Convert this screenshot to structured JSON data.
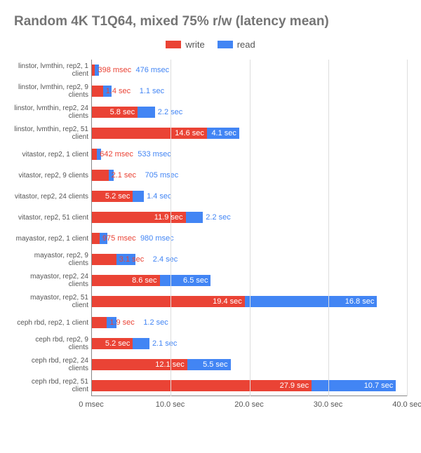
{
  "chart_data": {
    "type": "bar",
    "stacked": true,
    "orientation": "horizontal",
    "title": "Random 4K T1Q64, mixed 75% r/w (latency mean)",
    "xlim_sec": [
      0,
      40
    ],
    "xticks": [
      {
        "pct": 0,
        "label": "0 msec"
      },
      {
        "pct": 25,
        "label": "10.0 sec"
      },
      {
        "pct": 50,
        "label": "20.0 sec"
      },
      {
        "pct": 75,
        "label": "30.0 sec"
      },
      {
        "pct": 100,
        "label": "40.0 sec"
      }
    ],
    "legend": [
      {
        "key": "write",
        "label": "write",
        "color": "#ea4335"
      },
      {
        "key": "read",
        "label": "read",
        "color": "#4285f4"
      }
    ],
    "categories": [
      "linstor, lvmthin, rep2, 1 client",
      "linstor, lvmthin, rep2, 9 clients",
      "linstor, lvmthin, rep2, 24 clients",
      "linstor, lvmthin, rep2, 51 client",
      "vitastor, rep2, 1 client",
      "vitastor, rep2, 9 clients",
      "vitastor, rep2, 24 clients",
      "vitastor, rep2, 51 client",
      "mayastor, rep2, 1 client",
      "mayastor, rep2, 9 clients",
      "mayastor, rep2, 24 clients",
      "mayastor, rep2, 51 client",
      "ceph rbd, rep2, 1 client",
      "ceph rbd, rep2, 9 clients",
      "ceph rbd, rep2, 24 clients",
      "ceph rbd, rep2, 51 client"
    ],
    "series": [
      {
        "name": "write",
        "values_sec": [
          0.398,
          1.4,
          5.8,
          14.6,
          0.642,
          2.1,
          5.2,
          11.9,
          0.975,
          3.1,
          8.6,
          19.4,
          1.9,
          5.2,
          12.1,
          27.9
        ],
        "labels": [
          "398 msec",
          "1.4 sec",
          "5.8 sec",
          "14.6 sec",
          "642 msec",
          "2.1 sec",
          "5.2 sec",
          "11.9 sec",
          "975 msec",
          "3.1 sec",
          "8.6 sec",
          "19.4 sec",
          "1.9 sec",
          "5.2 sec",
          "12.1 sec",
          "27.9 sec"
        ]
      },
      {
        "name": "read",
        "values_sec": [
          0.476,
          1.1,
          2.2,
          4.1,
          0.533,
          0.705,
          1.4,
          2.2,
          0.98,
          2.4,
          6.5,
          16.8,
          1.2,
          2.1,
          5.5,
          10.7
        ],
        "labels": [
          "476 msec",
          "1.1 sec",
          "2.2 sec",
          "4.1 sec",
          "533 msec",
          "705 msec",
          "1.4 sec",
          "2.2 sec",
          "980 msec",
          "2.4 sec",
          "6.5 sec",
          "16.8 sec",
          "1.2 sec",
          "2.1 sec",
          "5.5 sec",
          "10.7 sec"
        ]
      }
    ]
  }
}
